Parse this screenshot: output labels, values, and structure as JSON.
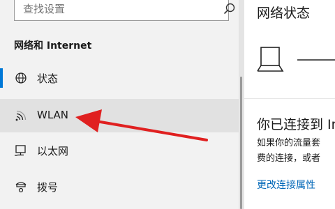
{
  "search": {
    "placeholder": "查找设置"
  },
  "sidebar": {
    "section_title": "网络和 Internet",
    "items": [
      {
        "label": "状态",
        "icon": "globe-icon"
      },
      {
        "label": "WLAN",
        "icon": "wifi-icon",
        "selected": true
      },
      {
        "label": "以太网",
        "icon": "ethernet-icon"
      },
      {
        "label": "拨号",
        "icon": "dialup-icon"
      }
    ]
  },
  "content": {
    "title": "网络状态",
    "connected_title": "你已连接到 In",
    "desc_line1": "如果你的流量套",
    "desc_line2": "费的连接，或者",
    "link_change_props": "更改连接属性"
  },
  "colors": {
    "accent": "#0078d7",
    "link": "#0067b8",
    "annotation_arrow": "#e02020",
    "sidebar_bg": "#f2f2f2",
    "selected_bg": "#e1e1e1"
  }
}
